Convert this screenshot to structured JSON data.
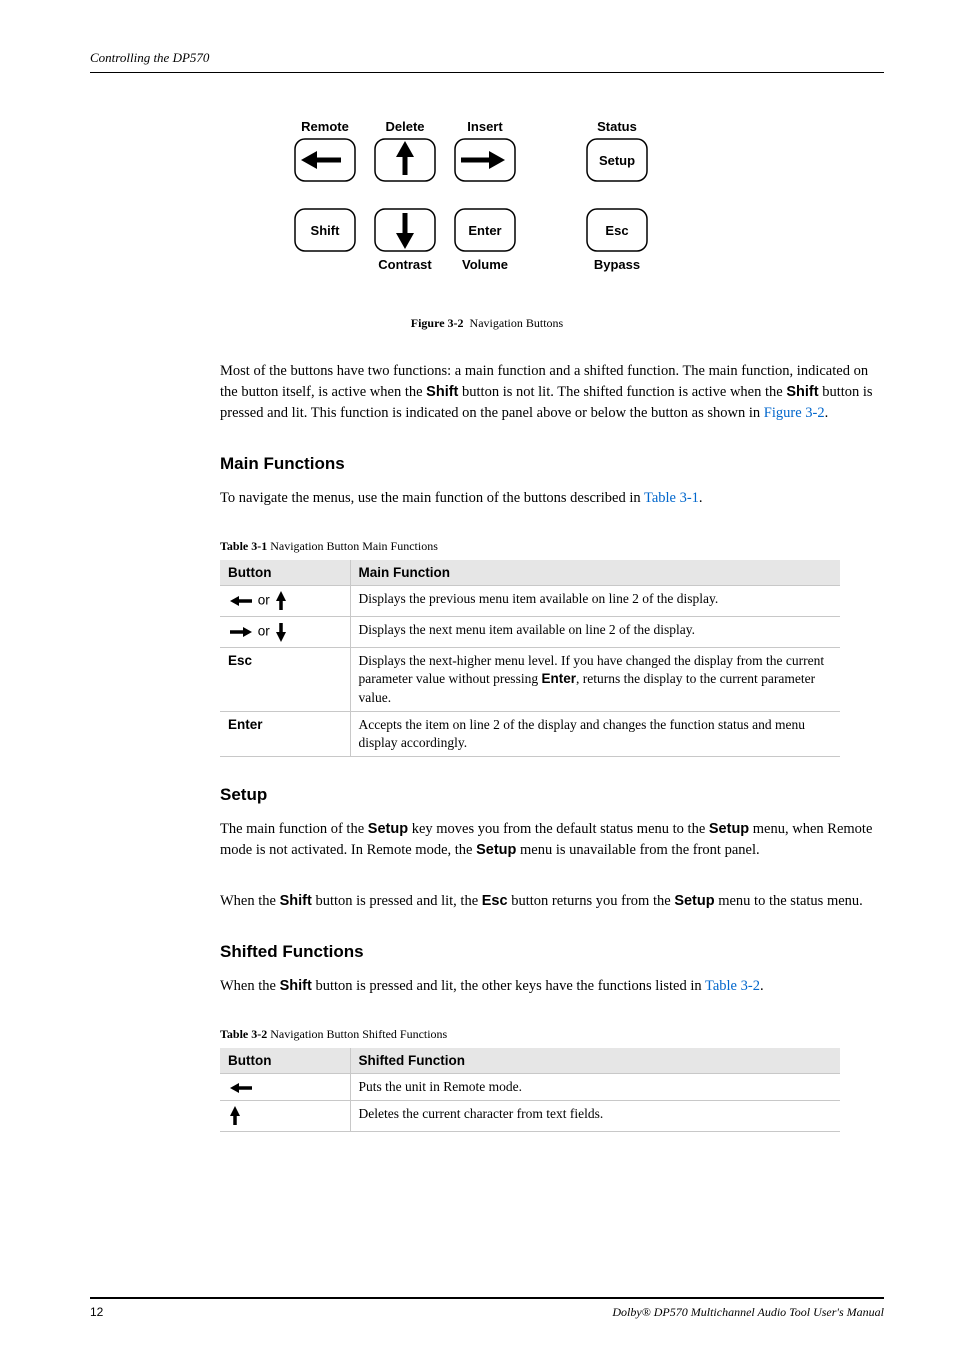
{
  "header": {
    "running": "Controlling the DP570"
  },
  "figure": {
    "labels": {
      "remote": "Remote",
      "delete": "Delete",
      "insert": "Insert",
      "status": "Status",
      "setup": "Setup",
      "shift": "Shift",
      "contrast": "Contrast",
      "enter": "Enter",
      "volume": "Volume",
      "esc": "Esc",
      "bypass": "Bypass"
    },
    "caption_label": "Figure 3-2",
    "caption_text": "Navigation Buttons"
  },
  "para1": {
    "t1": "Most of the buttons have two functions: a main function and a shifted function. The main function, indicated on the button itself, is active when the ",
    "b1": "Shift",
    "t2": " button is not lit. The shifted function is active when the ",
    "b2": "Shift",
    "t3": " button is pressed and lit. This function is indicated on the panel above or below the button as shown in ",
    "link": "Figure 3-2",
    "t4": "."
  },
  "sec_main": {
    "heading": "Main Functions",
    "para_t1": "To navigate the menus, use the main function of the buttons described in ",
    "para_link": "Table 3-1",
    "para_t2": "."
  },
  "table1": {
    "caption_label": "Table 3-1",
    "caption_text": "Navigation Button Main Functions",
    "head_button": "Button",
    "head_function": "Main Function",
    "rows": [
      {
        "btn_or": " or ",
        "desc": "Displays the previous menu item available on line 2 of the display."
      },
      {
        "btn_or": " or ",
        "desc": "Displays the next menu item available on line 2 of the display."
      },
      {
        "btn": "Esc",
        "d1": "Displays the next-higher menu level. If you have changed the display from the current parameter value without pressing ",
        "b": "Enter",
        "d2": ", returns the display to the current parameter value."
      },
      {
        "btn": "Enter",
        "desc": "Accepts the item on line 2 of the display and changes the function status and menu display accordingly."
      }
    ]
  },
  "sec_setup": {
    "heading": "Setup",
    "p1_t1": "The main function of the ",
    "p1_b1": "Setup",
    "p1_t2": " key moves you from the default status menu to the ",
    "p1_b2": "Setup",
    "p1_t3": " menu, when Remote mode is not activated. In Remote mode, the ",
    "p1_b3": "Setup",
    "p1_t4": " menu is unavailable from the front panel.",
    "p2_t1": "When the ",
    "p2_b1": "Shift",
    "p2_t2": " button is pressed and lit, the ",
    "p2_b2": "Esc",
    "p2_t3": " button returns you from the ",
    "p2_b3": "Setup",
    "p2_t4": " menu to the status menu."
  },
  "sec_shift": {
    "heading": "Shifted Functions",
    "para_t1": "When the ",
    "para_b": "Shift",
    "para_t2": " button is pressed and lit, the other keys have the functions listed in ",
    "para_link": "Table 3-2",
    "para_t3": "."
  },
  "table2": {
    "caption_label": "Table 3-2",
    "caption_text": "Navigation Button Shifted Functions",
    "head_button": "Button",
    "head_function": "Shifted Function",
    "rows": [
      {
        "desc": "Puts the unit in Remote mode."
      },
      {
        "desc": "Deletes the current character from text fields."
      }
    ]
  },
  "footer": {
    "page": "12",
    "title": "Dolby® DP570 Multichannel Audio Tool User's Manual"
  }
}
